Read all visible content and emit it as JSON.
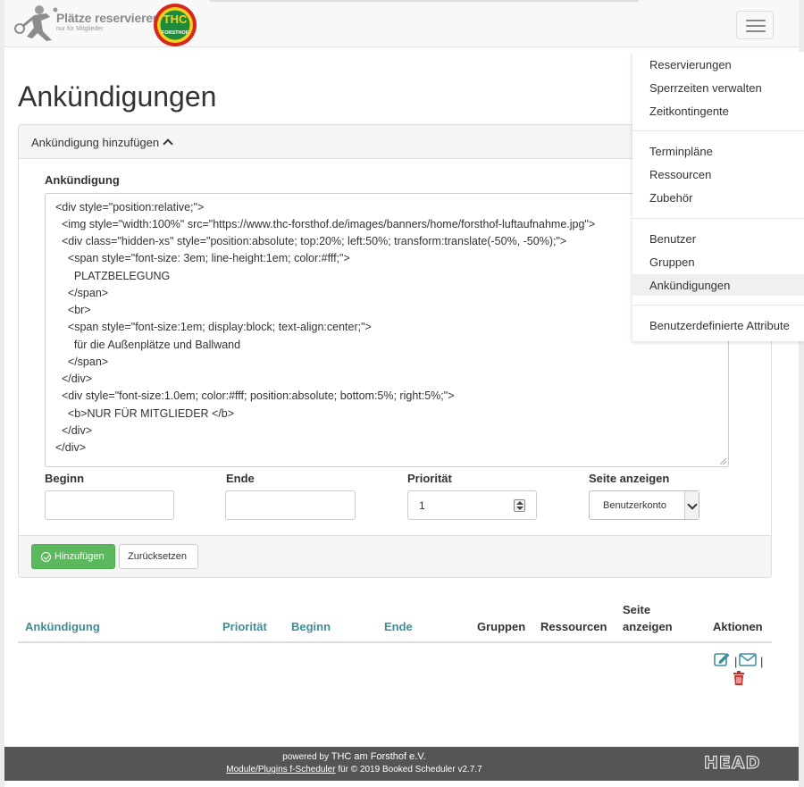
{
  "header": {
    "brand_title": "Plätze reservieren",
    "brand_subtitle": "nur für Mitglieder",
    "club_logo_text": "THC FORSTHOF"
  },
  "page_title": "Ankündigungen",
  "panel": {
    "toggle_label": "Ankündigung hinzufügen",
    "announcement_label": "Ankündigung",
    "code_lines": [
      "<div style=\"position:relative;\">",
      "  <img style=\"width:100%\" src=\"https://www.thc-forsthof.de/images/banners/home/forsthof-luftaufnahme.jpg\">",
      "  <div class=\"hidden-xs\" style=\"position:absolute; top:20%; left:50%; transform:translate(-50%, -50%);\">",
      "    <span style=\"font-size: 3em; line-height:1em; color:#fff;\">",
      "      PLATZBELEGUNG",
      "    </span>",
      "    <br>",
      "    <span style=\"font-size:1em; display:block; text-align:center;\">",
      "      für die Außenplätze und Ballwand",
      "    </span>",
      "  </div>",
      "  <div style=\"font-size:1.0em; color:#fff; position:absolute; bottom:5%; right:5%;\">",
      "    <b>NUR FÜR MITGLIEDER </b>",
      "  </div>",
      "</div>"
    ],
    "begin_label": "Beginn",
    "end_label": "Ende",
    "priority_label": "Priorität",
    "priority_value": "1",
    "display_label": "Seite anzeigen",
    "display_value": "Benutzerkonto",
    "add_button": "Hinzufügen",
    "reset_button": "Zurücksetzen"
  },
  "table": {
    "col_announcement": "Ankündigung",
    "col_priority": "Priorität",
    "col_begin": "Beginn",
    "col_end": "Ende",
    "col_groups": "Gruppen",
    "col_resources": "Ressourcen",
    "col_display_line1": "Seite",
    "col_display_line2": "anzeigen",
    "col_actions": "Aktionen",
    "separator": "|"
  },
  "footer": {
    "powered_by": "powered by",
    "org": "THC am Forsthof e.V.",
    "module_link": "Module/Plugins f-Scheduler",
    "rest": "für © 2019 Booked Scheduler v2.7.7",
    "sponsor": "HEAD"
  },
  "menu": {
    "items": [
      "Reservierungen",
      "Sperrzeiten verwalten",
      "Zeitkontingente",
      "Terminpläne",
      "Ressourcen",
      "Zubehör",
      "Benutzer",
      "Gruppen",
      "Ankündigungen",
      "Benutzerdefinierte Attribute"
    ],
    "active_index": 8
  },
  "colors": {
    "accent_link": "#3d8d9a",
    "success": "#5cb85c",
    "danger": "#c9302c",
    "footer_bg": "#555555"
  }
}
